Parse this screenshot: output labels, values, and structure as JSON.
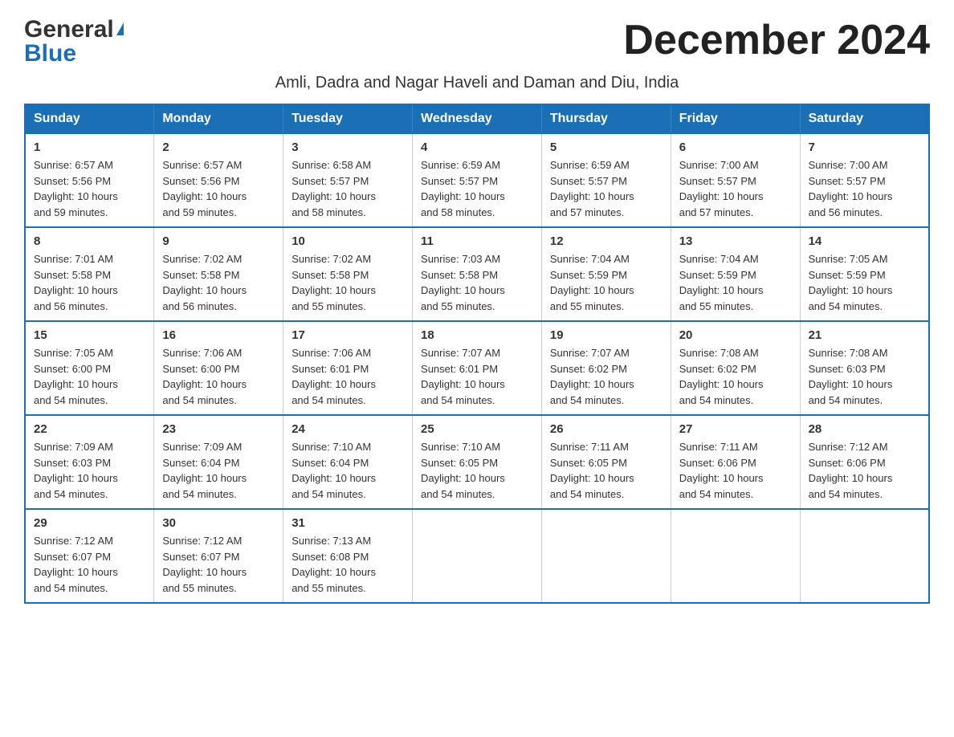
{
  "logo": {
    "general": "General",
    "blue": "Blue"
  },
  "header": {
    "month_year": "December 2024",
    "subtitle": "Amli, Dadra and Nagar Haveli and Daman and Diu, India"
  },
  "days_of_week": [
    "Sunday",
    "Monday",
    "Tuesday",
    "Wednesday",
    "Thursday",
    "Friday",
    "Saturday"
  ],
  "weeks": [
    [
      {
        "day": "1",
        "sunrise": "6:57 AM",
        "sunset": "5:56 PM",
        "daylight": "10 hours and 59 minutes."
      },
      {
        "day": "2",
        "sunrise": "6:57 AM",
        "sunset": "5:56 PM",
        "daylight": "10 hours and 59 minutes."
      },
      {
        "day": "3",
        "sunrise": "6:58 AM",
        "sunset": "5:57 PM",
        "daylight": "10 hours and 58 minutes."
      },
      {
        "day": "4",
        "sunrise": "6:59 AM",
        "sunset": "5:57 PM",
        "daylight": "10 hours and 58 minutes."
      },
      {
        "day": "5",
        "sunrise": "6:59 AM",
        "sunset": "5:57 PM",
        "daylight": "10 hours and 57 minutes."
      },
      {
        "day": "6",
        "sunrise": "7:00 AM",
        "sunset": "5:57 PM",
        "daylight": "10 hours and 57 minutes."
      },
      {
        "day": "7",
        "sunrise": "7:00 AM",
        "sunset": "5:57 PM",
        "daylight": "10 hours and 56 minutes."
      }
    ],
    [
      {
        "day": "8",
        "sunrise": "7:01 AM",
        "sunset": "5:58 PM",
        "daylight": "10 hours and 56 minutes."
      },
      {
        "day": "9",
        "sunrise": "7:02 AM",
        "sunset": "5:58 PM",
        "daylight": "10 hours and 56 minutes."
      },
      {
        "day": "10",
        "sunrise": "7:02 AM",
        "sunset": "5:58 PM",
        "daylight": "10 hours and 55 minutes."
      },
      {
        "day": "11",
        "sunrise": "7:03 AM",
        "sunset": "5:58 PM",
        "daylight": "10 hours and 55 minutes."
      },
      {
        "day": "12",
        "sunrise": "7:04 AM",
        "sunset": "5:59 PM",
        "daylight": "10 hours and 55 minutes."
      },
      {
        "day": "13",
        "sunrise": "7:04 AM",
        "sunset": "5:59 PM",
        "daylight": "10 hours and 55 minutes."
      },
      {
        "day": "14",
        "sunrise": "7:05 AM",
        "sunset": "5:59 PM",
        "daylight": "10 hours and 54 minutes."
      }
    ],
    [
      {
        "day": "15",
        "sunrise": "7:05 AM",
        "sunset": "6:00 PM",
        "daylight": "10 hours and 54 minutes."
      },
      {
        "day": "16",
        "sunrise": "7:06 AM",
        "sunset": "6:00 PM",
        "daylight": "10 hours and 54 minutes."
      },
      {
        "day": "17",
        "sunrise": "7:06 AM",
        "sunset": "6:01 PM",
        "daylight": "10 hours and 54 minutes."
      },
      {
        "day": "18",
        "sunrise": "7:07 AM",
        "sunset": "6:01 PM",
        "daylight": "10 hours and 54 minutes."
      },
      {
        "day": "19",
        "sunrise": "7:07 AM",
        "sunset": "6:02 PM",
        "daylight": "10 hours and 54 minutes."
      },
      {
        "day": "20",
        "sunrise": "7:08 AM",
        "sunset": "6:02 PM",
        "daylight": "10 hours and 54 minutes."
      },
      {
        "day": "21",
        "sunrise": "7:08 AM",
        "sunset": "6:03 PM",
        "daylight": "10 hours and 54 minutes."
      }
    ],
    [
      {
        "day": "22",
        "sunrise": "7:09 AM",
        "sunset": "6:03 PM",
        "daylight": "10 hours and 54 minutes."
      },
      {
        "day": "23",
        "sunrise": "7:09 AM",
        "sunset": "6:04 PM",
        "daylight": "10 hours and 54 minutes."
      },
      {
        "day": "24",
        "sunrise": "7:10 AM",
        "sunset": "6:04 PM",
        "daylight": "10 hours and 54 minutes."
      },
      {
        "day": "25",
        "sunrise": "7:10 AM",
        "sunset": "6:05 PM",
        "daylight": "10 hours and 54 minutes."
      },
      {
        "day": "26",
        "sunrise": "7:11 AM",
        "sunset": "6:05 PM",
        "daylight": "10 hours and 54 minutes."
      },
      {
        "day": "27",
        "sunrise": "7:11 AM",
        "sunset": "6:06 PM",
        "daylight": "10 hours and 54 minutes."
      },
      {
        "day": "28",
        "sunrise": "7:12 AM",
        "sunset": "6:06 PM",
        "daylight": "10 hours and 54 minutes."
      }
    ],
    [
      {
        "day": "29",
        "sunrise": "7:12 AM",
        "sunset": "6:07 PM",
        "daylight": "10 hours and 54 minutes."
      },
      {
        "day": "30",
        "sunrise": "7:12 AM",
        "sunset": "6:07 PM",
        "daylight": "10 hours and 55 minutes."
      },
      {
        "day": "31",
        "sunrise": "7:13 AM",
        "sunset": "6:08 PM",
        "daylight": "10 hours and 55 minutes."
      },
      null,
      null,
      null,
      null
    ]
  ],
  "labels": {
    "sunrise": "Sunrise:",
    "sunset": "Sunset:",
    "daylight": "Daylight:"
  }
}
